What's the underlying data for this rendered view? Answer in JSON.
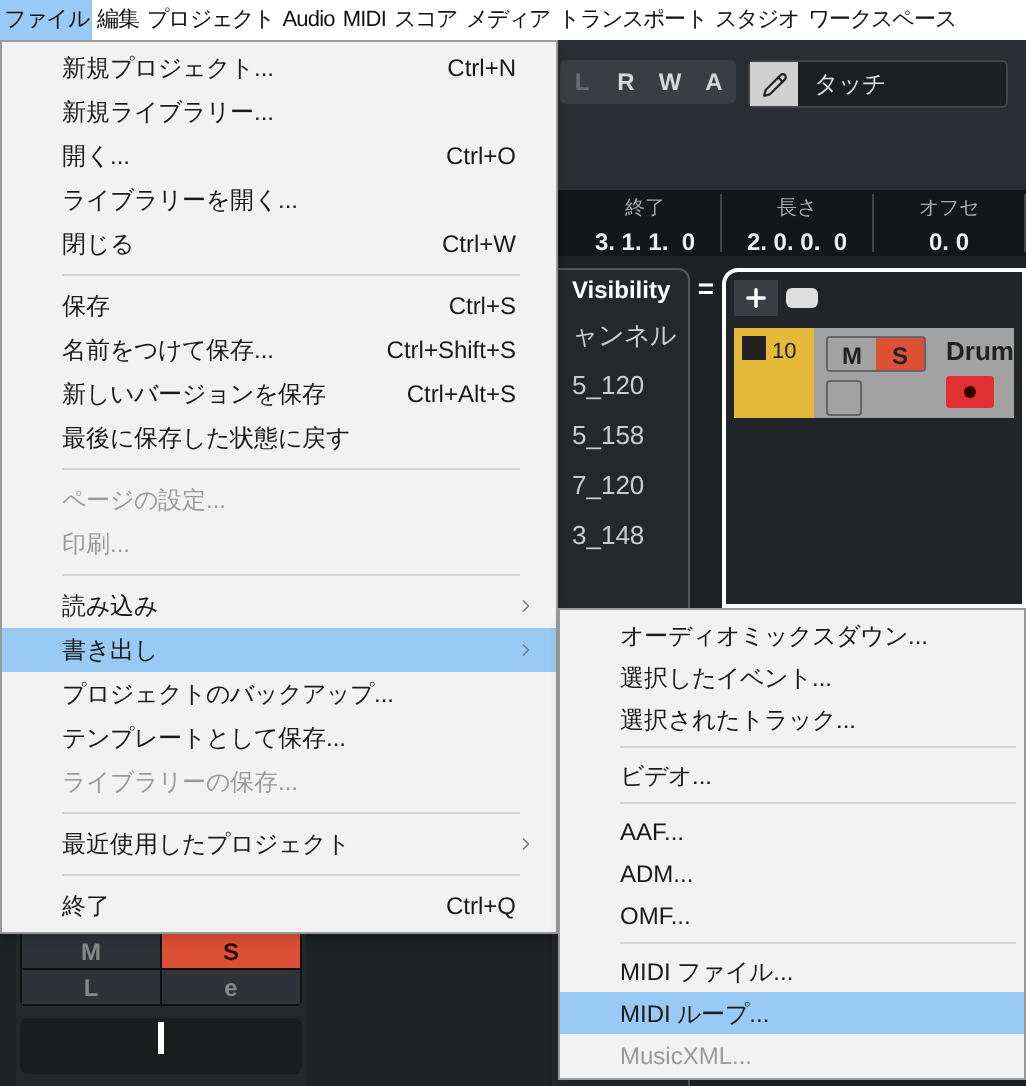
{
  "menubar": [
    {
      "label": "ファイル",
      "selected": true
    },
    {
      "label": "編集",
      "selected": false
    },
    {
      "label": "プロジェクト",
      "selected": false
    },
    {
      "label": "Audio",
      "selected": false
    },
    {
      "label": "MIDI",
      "selected": false
    },
    {
      "label": "スコア",
      "selected": false
    },
    {
      "label": "メディア",
      "selected": false
    },
    {
      "label": "トランスポート",
      "selected": false
    },
    {
      "label": "スタジオ",
      "selected": false
    },
    {
      "label": "ワークスペース",
      "selected": false
    }
  ],
  "toolbar": {
    "buttons": [
      {
        "label": "L",
        "on": false
      },
      {
        "label": "R",
        "on": true
      },
      {
        "label": "W",
        "on": true
      },
      {
        "label": "A",
        "on": true
      }
    ],
    "automation_mode": "タッチ"
  },
  "info": [
    {
      "label": "終了",
      "value": "3. 1. 1.  0"
    },
    {
      "label": "長さ",
      "value": "2. 0. 0.  0"
    },
    {
      "label": "オフセ",
      "value": "0. 0"
    }
  ],
  "visibility": {
    "tab": "Visibility",
    "menu_glyph": "=",
    "items": [
      "ャンネル",
      "5_120",
      "5_158",
      "7_120",
      "3_148"
    ]
  },
  "track": {
    "number": "10",
    "buttons": [
      {
        "label": "M",
        "on": false
      },
      {
        "label": "S",
        "on": true
      }
    ],
    "name": "Drum",
    "record": true,
    "checked": false
  },
  "mixer": {
    "buttons": [
      {
        "label": "M",
        "on": false
      },
      {
        "label": "S",
        "on": true
      },
      {
        "label": "L",
        "on": false
      },
      {
        "label": "e",
        "on": false
      }
    ]
  },
  "file_menu": [
    {
      "kind": "item",
      "label": "新規プロジェクト...",
      "shortcut": "Ctrl+N",
      "disabled": false,
      "selected": false,
      "submenu": false
    },
    {
      "kind": "item",
      "label": "新規ライブラリー...",
      "disabled": false,
      "selected": false,
      "submenu": false
    },
    {
      "kind": "item",
      "label": "開く...",
      "shortcut": "Ctrl+O",
      "disabled": false,
      "selected": false,
      "submenu": false
    },
    {
      "kind": "item",
      "label": "ライブラリーを開く...",
      "disabled": false,
      "selected": false,
      "submenu": false
    },
    {
      "kind": "item",
      "label": "閉じる",
      "shortcut": "Ctrl+W",
      "disabled": false,
      "selected": false,
      "submenu": false
    },
    {
      "kind": "separator"
    },
    {
      "kind": "item",
      "label": "保存",
      "shortcut": "Ctrl+S",
      "disabled": false,
      "selected": false,
      "submenu": false
    },
    {
      "kind": "item",
      "label": "名前をつけて保存...",
      "shortcut": "Ctrl+Shift+S",
      "disabled": false,
      "selected": false,
      "submenu": false
    },
    {
      "kind": "item",
      "label": "新しいバージョンを保存",
      "shortcut": "Ctrl+Alt+S",
      "disabled": false,
      "selected": false,
      "submenu": false
    },
    {
      "kind": "item",
      "label": "最後に保存した状態に戻す",
      "disabled": false,
      "selected": false,
      "submenu": false
    },
    {
      "kind": "separator"
    },
    {
      "kind": "item",
      "label": "ページの設定...",
      "disabled": true,
      "selected": false,
      "submenu": false
    },
    {
      "kind": "item",
      "label": "印刷...",
      "disabled": true,
      "selected": false,
      "submenu": false
    },
    {
      "kind": "separator"
    },
    {
      "kind": "item",
      "label": "読み込み",
      "disabled": false,
      "selected": false,
      "submenu": true
    },
    {
      "kind": "item",
      "label": "書き出し",
      "disabled": false,
      "selected": true,
      "submenu": true
    },
    {
      "kind": "item",
      "label": "プロジェクトのバックアップ...",
      "disabled": false,
      "selected": false,
      "submenu": false
    },
    {
      "kind": "item",
      "label": "テンプレートとして保存...",
      "disabled": false,
      "selected": false,
      "submenu": false
    },
    {
      "kind": "item",
      "label": "ライブラリーの保存...",
      "disabled": true,
      "selected": false,
      "submenu": false
    },
    {
      "kind": "separator"
    },
    {
      "kind": "item",
      "label": "最近使用したプロジェクト",
      "disabled": false,
      "selected": false,
      "submenu": true
    },
    {
      "kind": "separator"
    },
    {
      "kind": "item",
      "label": "終了",
      "shortcut": "Ctrl+Q",
      "disabled": false,
      "selected": false,
      "submenu": false
    }
  ],
  "export_submenu": [
    {
      "kind": "item",
      "label": "オーディオミックスダウン...",
      "disabled": false,
      "selected": false
    },
    {
      "kind": "item",
      "label": "選択したイベント...",
      "disabled": false,
      "selected": false
    },
    {
      "kind": "item",
      "label": "選択されたトラック...",
      "disabled": false,
      "selected": false
    },
    {
      "kind": "separator"
    },
    {
      "kind": "item",
      "label": "ビデオ...",
      "disabled": false,
      "selected": false
    },
    {
      "kind": "separator"
    },
    {
      "kind": "item",
      "label": "AAF...",
      "disabled": false,
      "selected": false
    },
    {
      "kind": "item",
      "label": "ADM...",
      "disabled": false,
      "selected": false
    },
    {
      "kind": "item",
      "label": "OMF...",
      "disabled": false,
      "selected": false
    },
    {
      "kind": "separator"
    },
    {
      "kind": "item",
      "label": "MIDI ファイル...",
      "disabled": false,
      "selected": false
    },
    {
      "kind": "item",
      "label": "MIDI ループ...",
      "disabled": false,
      "selected": true
    },
    {
      "kind": "item",
      "label": "MusicXML...",
      "disabled": true,
      "selected": false
    }
  ]
}
